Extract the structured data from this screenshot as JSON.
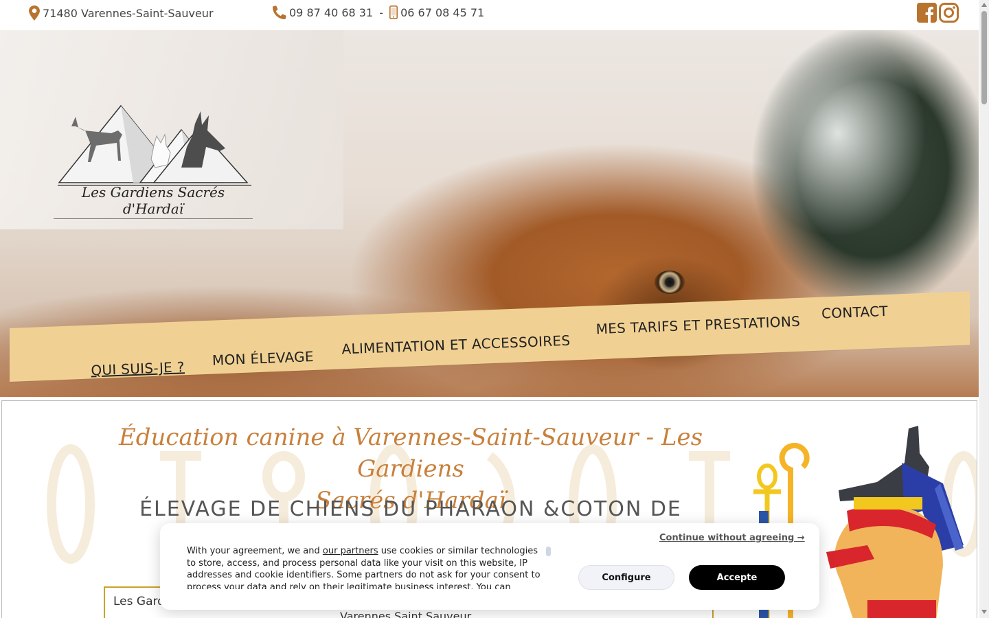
{
  "topbar": {
    "address_icon": "map-marker-icon",
    "address": "71480 Varennes-Saint-Sauveur",
    "phone_icon": "phone-icon",
    "phone_fixed": "09 87 40 68 31",
    "phone_separator": " - ",
    "mobile_icon": "mobile-phone-icon",
    "phone_mobile": "06 67 08 45 71",
    "social": [
      "facebook-icon",
      "instagram-icon"
    ]
  },
  "logo": {
    "text": "Les Gardiens Sacrés d'Hardaï"
  },
  "nav": {
    "items": [
      {
        "label": "Qui suis-je ?",
        "active": true
      },
      {
        "label": "Mon élevage",
        "active": false
      },
      {
        "label": "Alimentation et accessoires",
        "active": false
      },
      {
        "label": "Mes tarifs et prestations",
        "active": false
      },
      {
        "label": "Contact",
        "active": false
      }
    ]
  },
  "main": {
    "headline_line1": "Éducation canine à Varennes-Saint-Sauveur - Les Gardiens",
    "headline_line2": "Sacrés d'Hardaï",
    "subheadline": "ÉLEVAGE DE CHIENS DU PHARAON &COTON DE",
    "box_text": "Les Gard",
    "box_line2": "Varennes Saint Sauveur"
  },
  "cookie": {
    "text_before_link": "With your agreement, we and ",
    "partners_link": "our partners",
    "text_after_link": " use cookies or similar technologies to store, access, and process personal data like your visit on this website, IP addresses and cookie identifiers. Some partners do not ask for your consent to process your data and rely on their legitimate business interest. You can",
    "continue_label": "Continue without agreeing →",
    "configure_label": "Configure",
    "accept_label": "Accepte"
  },
  "colors": {
    "accent_gold": "#c8803b",
    "nav_ribbon": "#f1d193",
    "icon_brown": "#b8742f",
    "box_border": "#c9a227"
  }
}
